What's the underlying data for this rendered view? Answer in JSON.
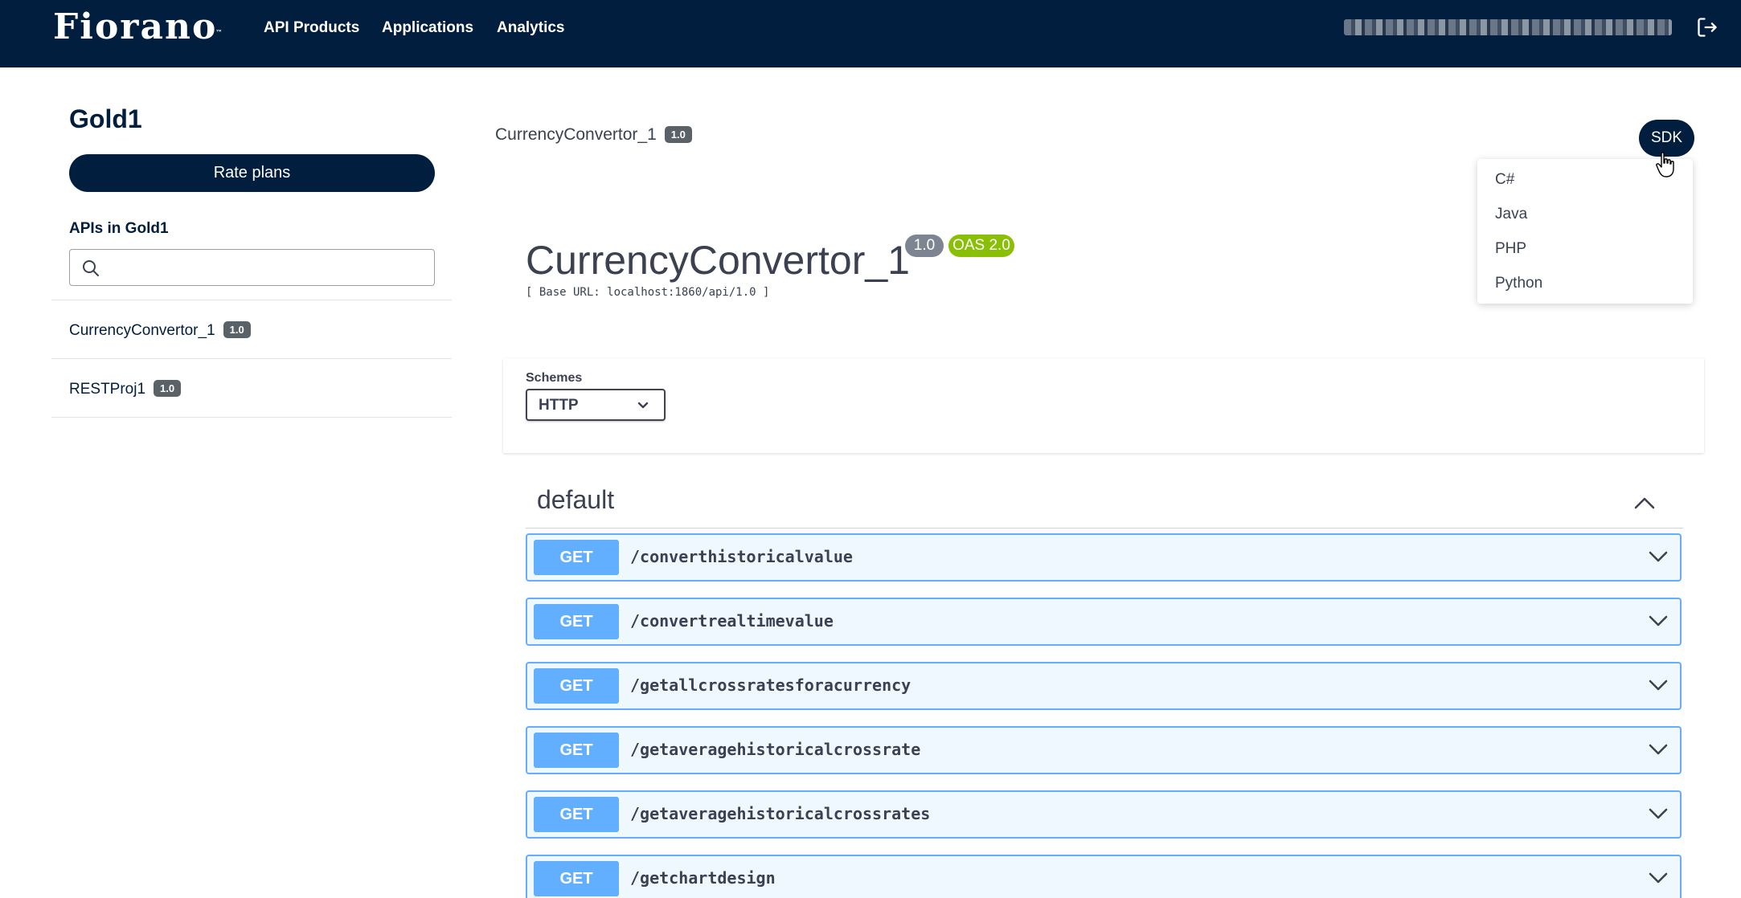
{
  "navbar": {
    "logo": "Fiorano",
    "logo_mark": "™",
    "links": [
      "API Products",
      "Applications",
      "Analytics"
    ],
    "logout_icon": "logout-icon"
  },
  "sidebar": {
    "title": "Gold1",
    "rate_plans_label": "Rate plans",
    "apis_heading": "APIs in Gold1",
    "search_icon": "search-icon",
    "apis": [
      {
        "name": "CurrencyConvertor_1",
        "version": "1.0"
      },
      {
        "name": "RESTProj1",
        "version": "1.0"
      }
    ]
  },
  "breadcrumb": {
    "name": "CurrencyConvertor_1",
    "version": "1.0"
  },
  "sdk": {
    "label": "SDK",
    "options": [
      "C#",
      "Java",
      "PHP",
      "Python"
    ]
  },
  "api": {
    "title": "CurrencyConvertor_1",
    "version_badge": "1.0",
    "oas_badge": "OAS 2.0",
    "base_url": "[ Base URL: localhost:1860/api/1.0 ]"
  },
  "schemes": {
    "label": "Schemes",
    "selected": "HTTP"
  },
  "tag": {
    "name": "default"
  },
  "operations": [
    {
      "method": "GET",
      "path": "/converthistoricalvalue"
    },
    {
      "method": "GET",
      "path": "/convertrealtimevalue"
    },
    {
      "method": "GET",
      "path": "/getallcrossratesforacurrency"
    },
    {
      "method": "GET",
      "path": "/getaveragehistoricalcrossrate"
    },
    {
      "method": "GET",
      "path": "/getaveragehistoricalcrossrates"
    },
    {
      "method": "GET",
      "path": "/getchartdesign"
    }
  ],
  "colors": {
    "navy": "#021e3f",
    "get_blue": "#61affe",
    "oas_green": "#89bf04",
    "badge_gray": "#5a6268"
  }
}
